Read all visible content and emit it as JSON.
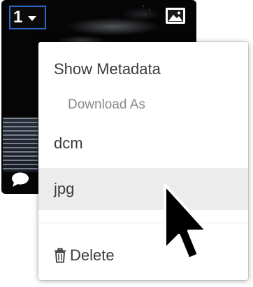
{
  "thumbnail": {
    "frame_number": "1",
    "frame_caret_icon": "caret-down-icon",
    "image_icon": "image-icon",
    "comment_icon": "speech-bubble-icon"
  },
  "menu": {
    "show_metadata": "Show Metadata",
    "download_header": "Download As",
    "download_options": [
      "dcm",
      "jpg"
    ],
    "delete_label": "Delete",
    "delete_icon": "trash-icon",
    "hovered_item": "jpg"
  },
  "cursor": {
    "icon": "arrow-pointer-icon"
  },
  "colors": {
    "selector_border": "#2f66c8",
    "menu_background": "#ffffff",
    "hover_background": "#ececec",
    "menu_text": "#3c3c3c",
    "header_text": "#8a8a8a"
  }
}
